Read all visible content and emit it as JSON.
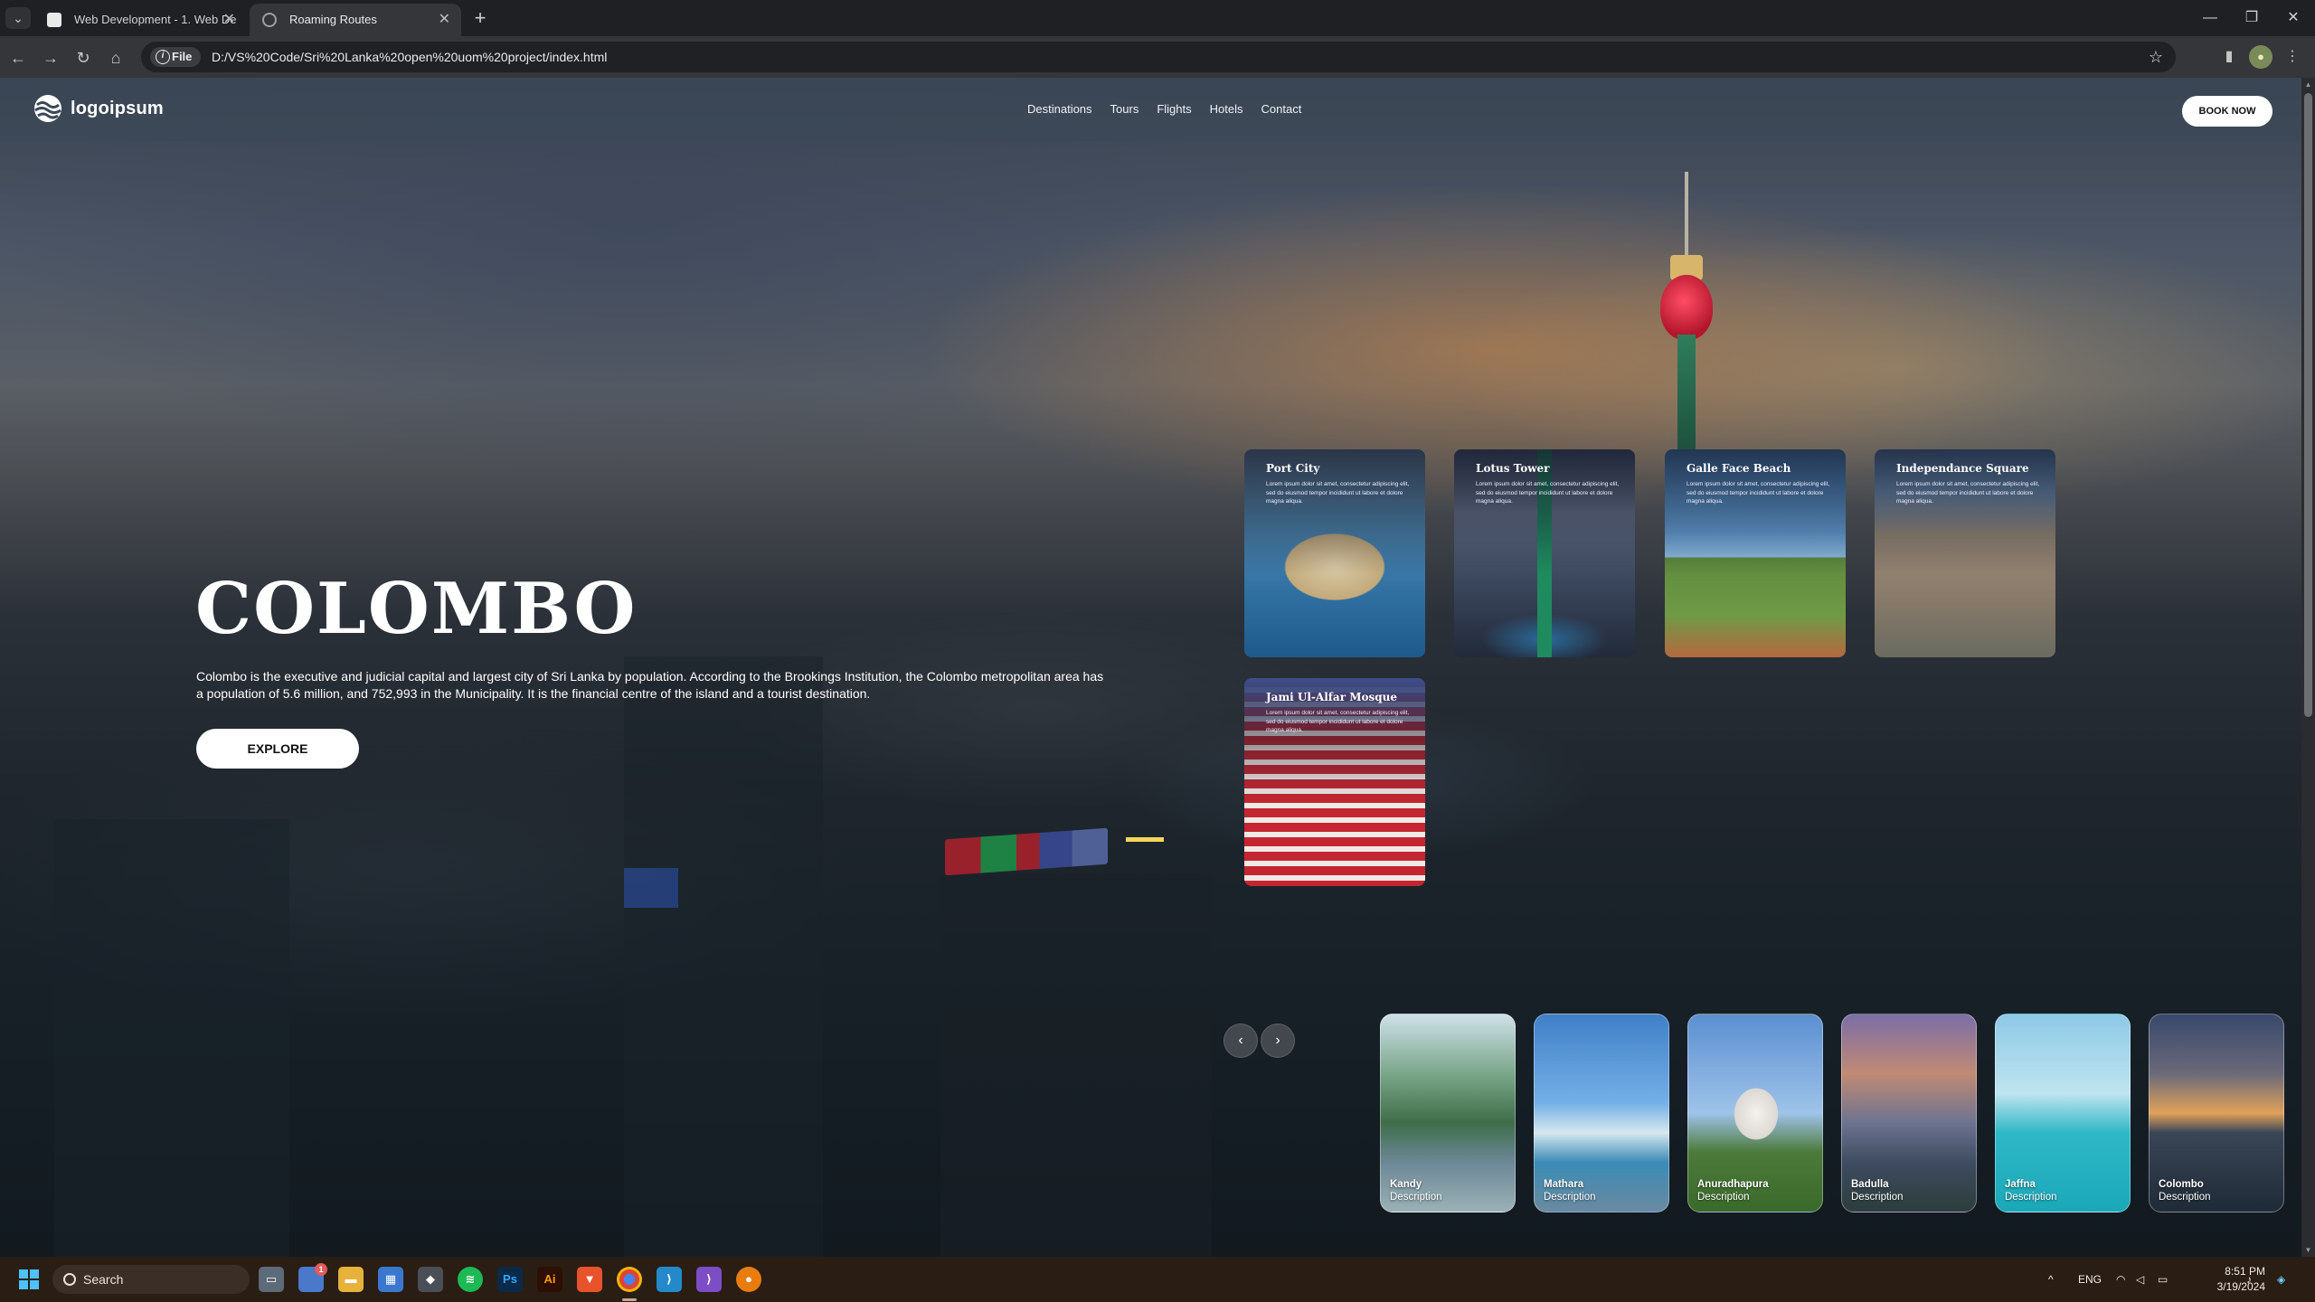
{
  "browser": {
    "tabs": [
      {
        "title": "Web Development - 1. Web De",
        "active": false
      },
      {
        "title": "Roaming Routes",
        "active": true
      }
    ],
    "url_scheme": "File",
    "url": "D:/VS%20Code/Sri%20Lanka%20open%20uom%20project/index.html"
  },
  "site": {
    "logo": "logoipsum",
    "nav": [
      "Destinations",
      "Tours",
      "Flights",
      "Hotels",
      "Contact"
    ],
    "book_now": "BOOK NOW"
  },
  "hero": {
    "title": "COLOMBO",
    "description": "Colombo is the executive and judicial capital and largest city of Sri Lanka by population. According to the Brookings Institution, the Colombo metropolitan area has a population of 5.6 million, and 752,993 in the Municipality. It is the financial centre of the island and a tourist destination.",
    "explore": "EXPLORE"
  },
  "attractions": [
    {
      "title": "Port City",
      "text": "Lorem ipsum dolor sit amet, consectetur adipiscing elit, sed do eiusmod tempor incididunt ut labore et dolore magna aliqua."
    },
    {
      "title": "Lotus Tower",
      "text": "Lorem ipsum dolor sit amet, consectetur adipiscing elit, sed do eiusmod tempor incididunt ut labore et dolore magna aliqua."
    },
    {
      "title": "Galle Face Beach",
      "text": "Lorem ipsum dolor sit amet, consectetur adipiscing elit, sed do eiusmod tempor incididunt ut labore et dolore magna aliqua."
    },
    {
      "title": "Independance Square",
      "text": "Lorem ipsum dolor sit amet, consectetur adipiscing elit, sed do eiusmod tempor incididunt ut labore et dolore magna aliqua."
    },
    {
      "title": "Jami Ul-Alfar Mosque",
      "text": "Lorem ipsum dolor sit amet, consectetur adipiscing elit, sed do eiusmod tempor incididunt ut labore et dolore magna aliqua."
    }
  ],
  "slider": {
    "prev": "‹",
    "next": "›"
  },
  "destinations": [
    {
      "name": "Kandy",
      "sub": "Description"
    },
    {
      "name": "Mathara",
      "sub": "Description"
    },
    {
      "name": "Anuradhapura",
      "sub": "Description"
    },
    {
      "name": "Badulla",
      "sub": "Description"
    },
    {
      "name": "Jaffna",
      "sub": "Description"
    },
    {
      "name": "Colombo",
      "sub": "Description"
    }
  ],
  "taskbar": {
    "search_placeholder": "Search",
    "lang": "ENG",
    "time": "8:51 PM",
    "date": "3/19/2024",
    "badge": "1"
  },
  "colors": {
    "accent": "#ffffff",
    "header_bg": "rgba(58,72,88,0.55)"
  }
}
